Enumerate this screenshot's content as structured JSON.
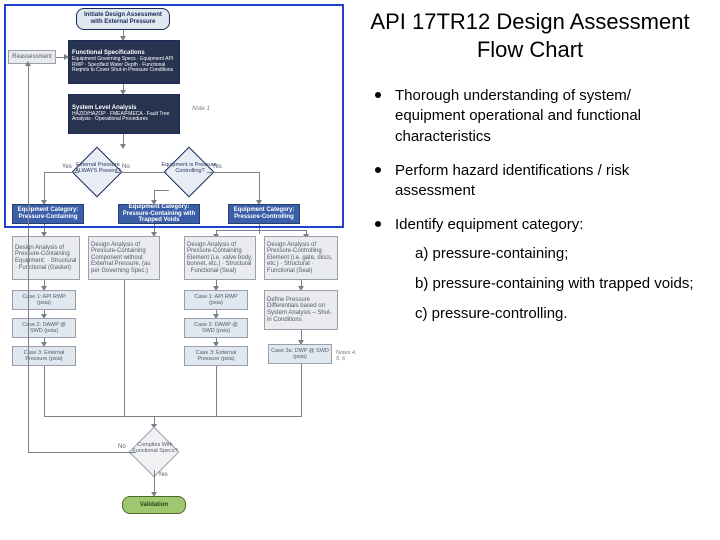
{
  "title": "API 17TR12  Design Assessment Flow Chart",
  "bullets": [
    {
      "text": "Thorough understanding of system/ equipment operational and functional characteristics"
    },
    {
      "text": "Perform hazard identifications / risk assessment"
    },
    {
      "text": "Identify equipment category:",
      "sub": [
        "a) pressure-containing;",
        "b) pressure-containing with trapped voids;",
        "c) pressure-controlling."
      ]
    }
  ],
  "flow": {
    "start": "Initiate Design Assessment with External Pressure",
    "funcspec_title": "Functional Specifications",
    "funcspec_body": "Equipment Governing Specs · Equipment API RWP · Specified Water Depth · Functional Reqmts to Cover Shut-in Pressure Conditions",
    "reassess": "Reassessment",
    "syslevel_title": "System Level Analysis",
    "syslevel_body": "HAZID/HAZOP · FMEA/FMECA · Fault Tree Analysis · Operational Procedures",
    "note1": "Note 1",
    "d1": "External Pressure ALWAYS Present?",
    "d2": "Equipment is Pressure-Controlling?",
    "yes": "Yes",
    "no": "No",
    "cat1": "Equipment Category: Pressure-Containing",
    "cat2": "Equipment Category: Pressure-Containing with Trapped Voids",
    "cat3": "Equipment Category: Pressure-Controlling",
    "analysis1": "Design Analysis of Pressure-Containing Equipment: · Structural · Functional (Gasket)",
    "analysis2": "Design Analysis of Pressure-Containing Component without External Pressure, (as per Governing Spec.)",
    "analysis3": "Design Analysis of Pressure-Containing Element (i.e. valve body, bonnet, etc.) · Structural · Functional (Seal)",
    "analysis4": "Design Analysis of Pressure-Controlling Element (i.e. gate, discs, etc.) · Structural · Functional (Seal)",
    "c1": "Case 1: API RWP (psia)",
    "c2": "Case 2: DAWP @ SWD (psia)",
    "c3": "Case 3: External Pressure (psia)",
    "c4": "Case 1: API RWP (psia)",
    "c5": "Case 2: DAWP @ SWD (psia)",
    "c6": "Case 3: External Pressure (psia)",
    "diffbox": "Define Pressure Differentials based on System Analysis – Shut-in Conditions",
    "c7": "Case 3a: DWP @ SWD (psia)",
    "notes456": "Notes 4, 5, 6",
    "d3": "Complies With Functional Specs?",
    "validation": "Validation"
  }
}
